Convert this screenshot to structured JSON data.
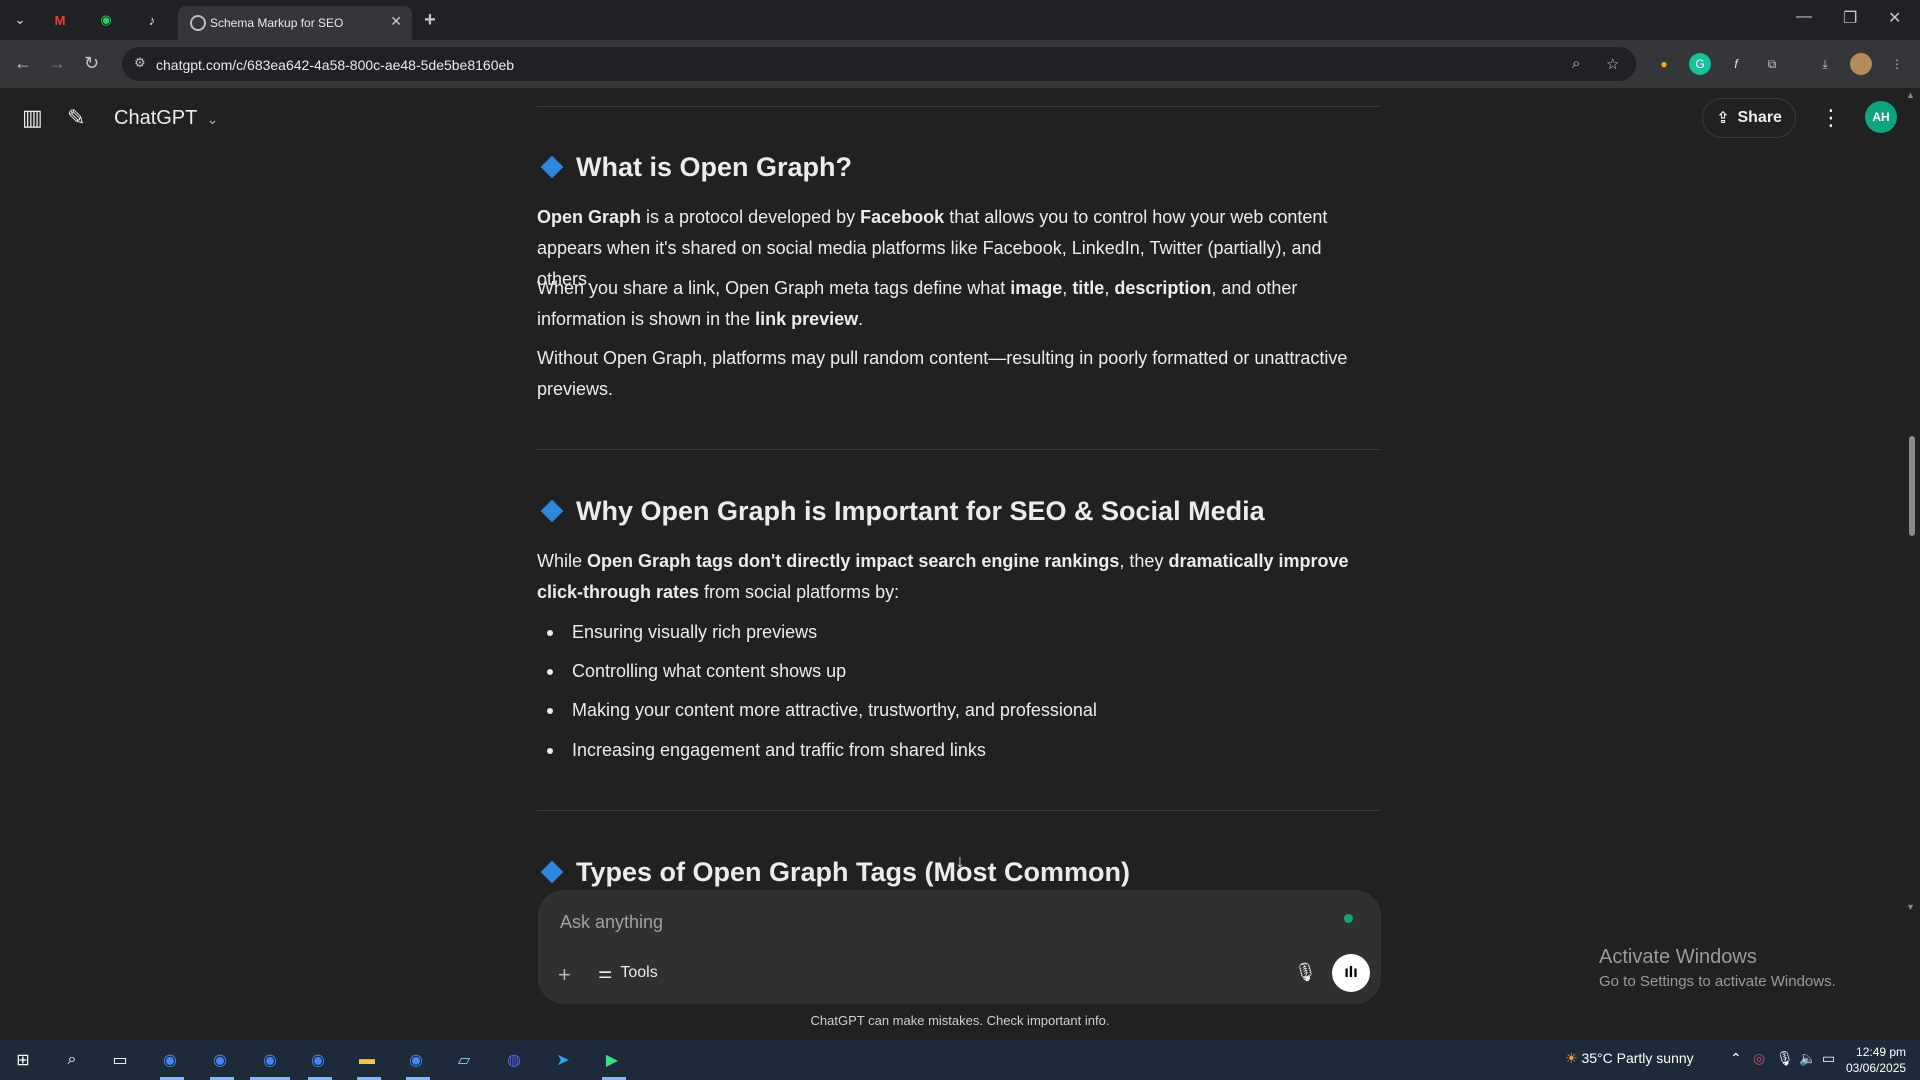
{
  "browser": {
    "active_tab_title": "Schema Markup for SEO",
    "new_tab": "+",
    "url": "chatgpt.com/c/683ea642-4a58-800c-ae48-5de5be8160eb"
  },
  "app": {
    "brand": "ChatGPT",
    "share_label": "Share",
    "avatar_initials": "AH"
  },
  "sections": [
    {
      "heading": "What is Open Graph?",
      "paragraphs": [
        "<b>Open Graph</b> is a protocol developed by <b>Facebook</b> that allows you to control how your web content appears when it's shared on social media platforms like Facebook, LinkedIn, Twitter (partially), and others.",
        "When you share a link, Open Graph meta tags define what <b>image</b>, <b>title</b>, <b>description</b>, and other information is shown in the <b>link preview</b>.",
        "Without Open Graph, platforms may pull random content—resulting in poorly formatted or unattractive previews."
      ]
    },
    {
      "heading": "Why Open Graph is Important for SEO & Social Media",
      "paragraphs": [
        "While <b>Open Graph tags don't directly impact search engine rankings</b>, they <b>dramatically improve click-through rates</b> from social platforms by:"
      ],
      "bullets": [
        "Ensuring visually rich previews",
        "Controlling what content shows up",
        "Making your content more attractive, trustworthy, and professional",
        "Increasing engagement and traffic from shared links"
      ]
    },
    {
      "heading": "Types of Open Graph Tags (Most Common)"
    }
  ],
  "composer": {
    "placeholder": "Ask anything",
    "tools_label": "Tools"
  },
  "disclaimer": "ChatGPT can make mistakes. Check important info.",
  "watermark": {
    "line1": "Activate Windows",
    "line2": "Go to Settings to activate Windows."
  },
  "taskbar": {
    "weather": "35°C  Partly sunny",
    "time": "12:49 pm",
    "date": "03/06/2025"
  },
  "colors": {
    "background": "#212121",
    "accent_diamond": "#2e86de",
    "avatar": "#10a37f"
  }
}
